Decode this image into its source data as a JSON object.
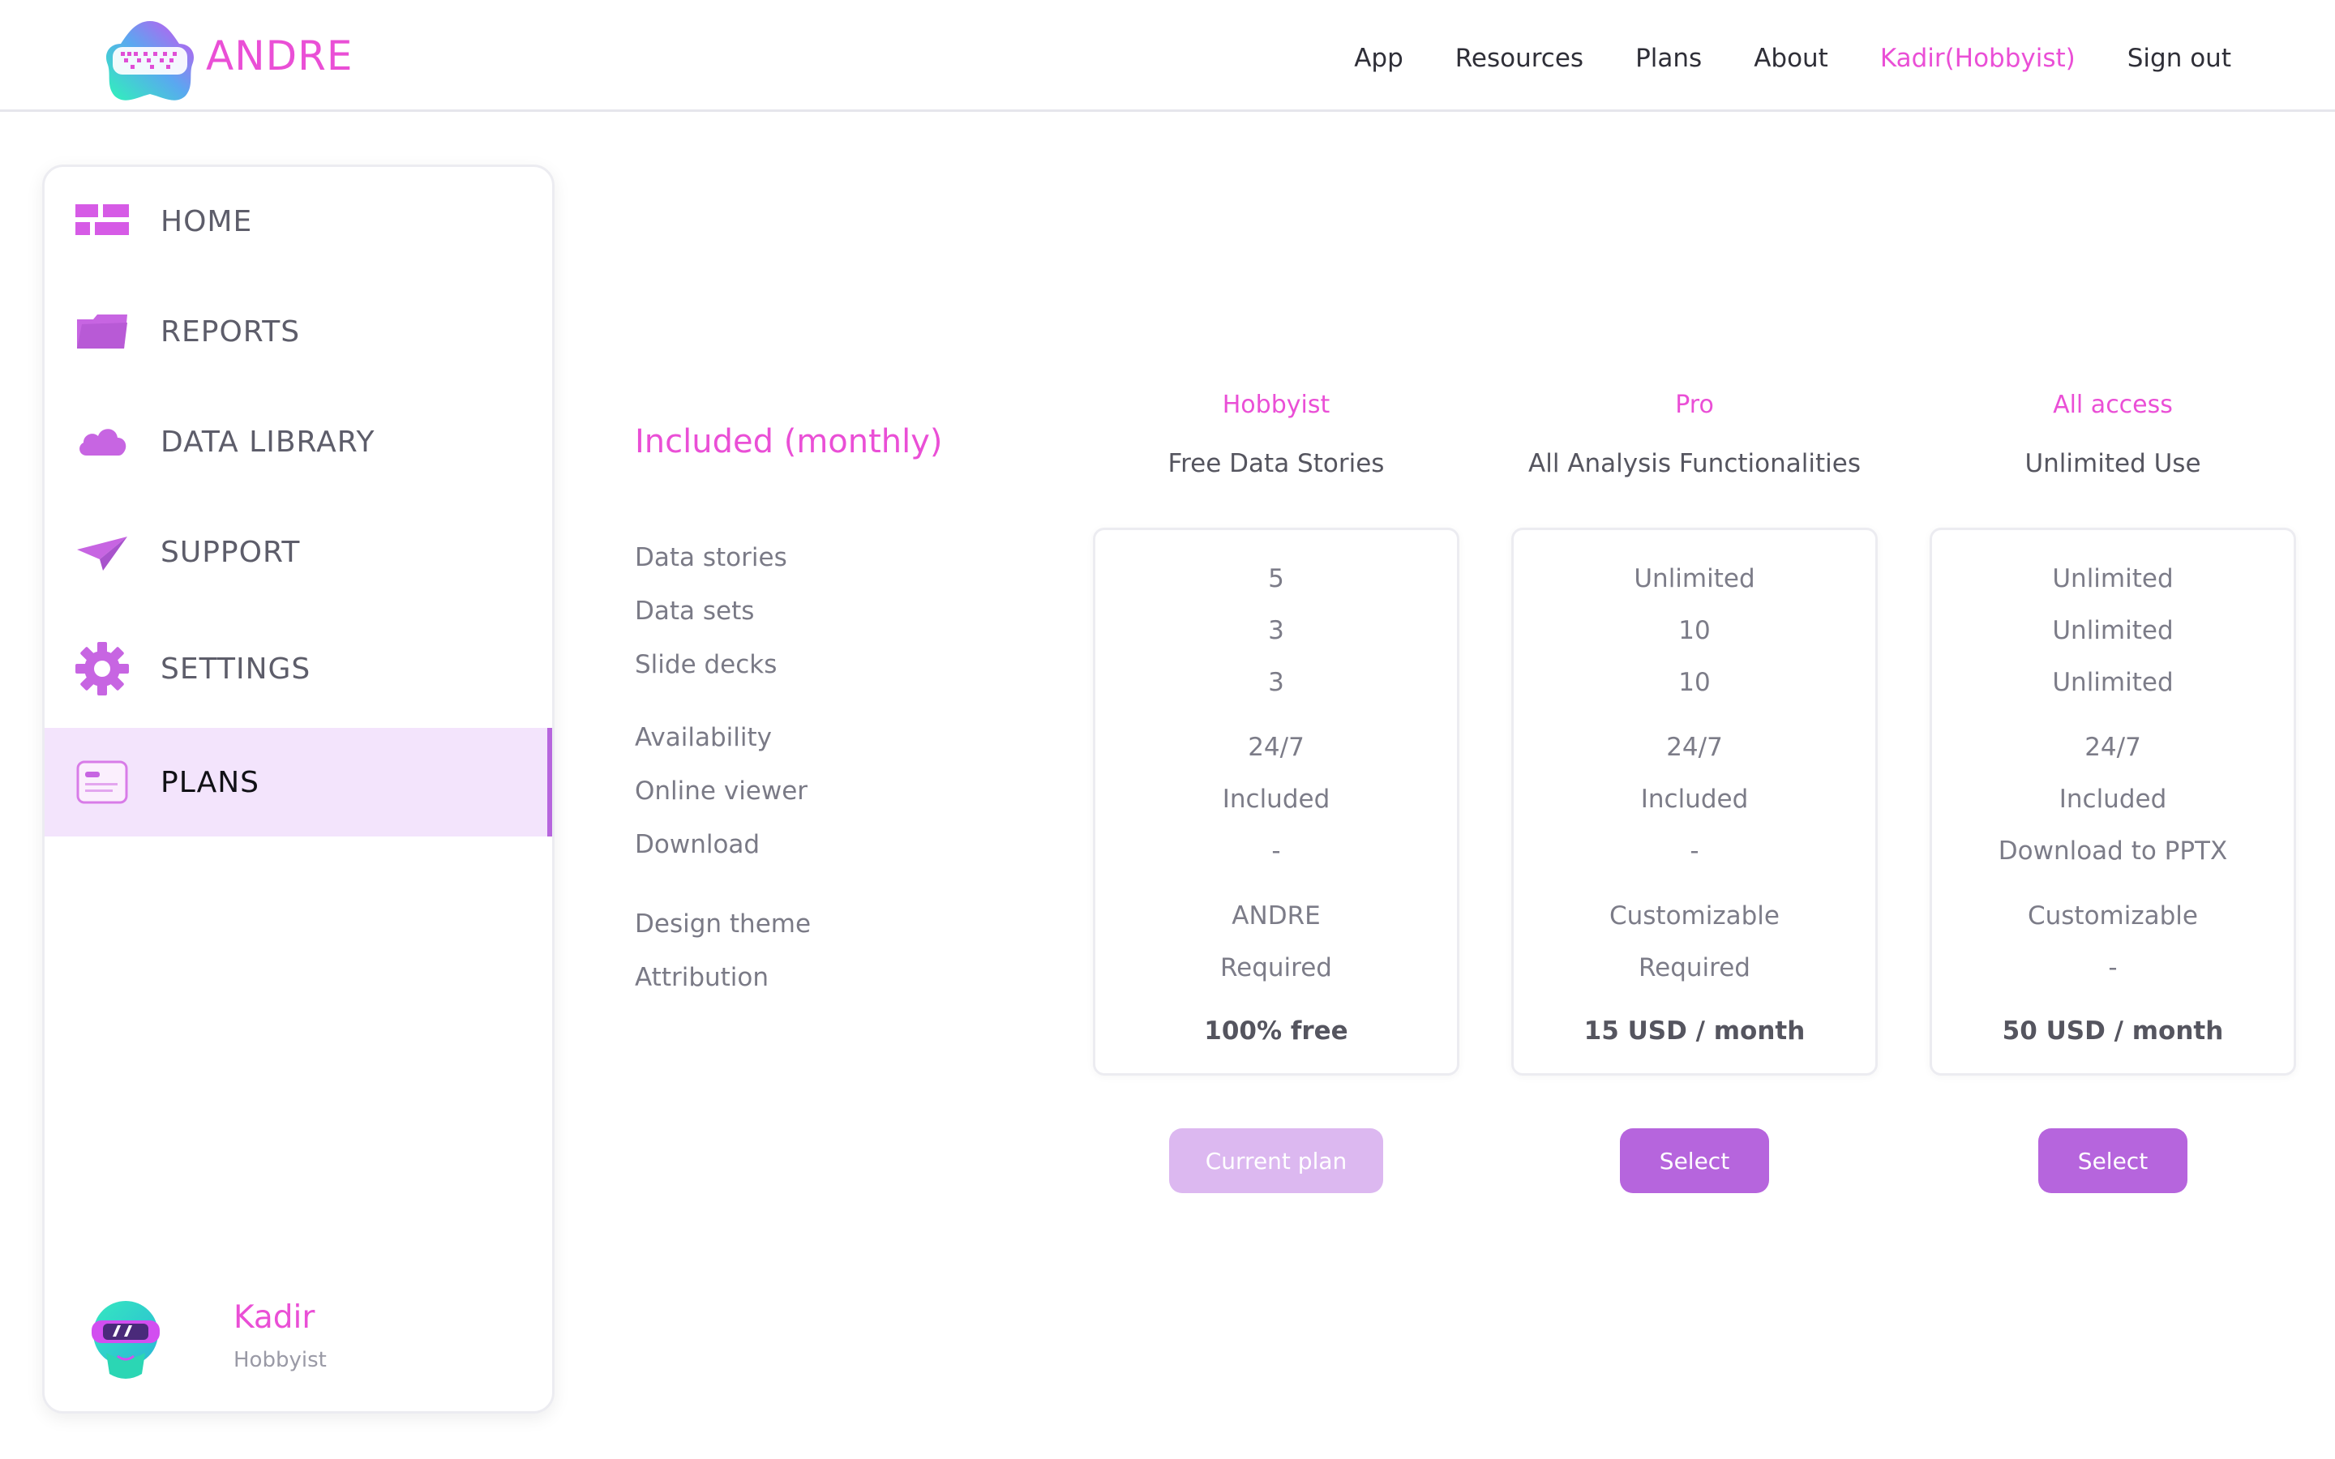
{
  "brand": {
    "name": "ANDRE"
  },
  "nav": {
    "items": [
      "App",
      "Resources",
      "Plans",
      "About",
      "Kadir(Hobbyist)",
      "Sign out"
    ]
  },
  "sidebar": {
    "items": [
      {
        "label": "HOME",
        "icon": "home-grid-icon"
      },
      {
        "label": "REPORTS",
        "icon": "folder-icon"
      },
      {
        "label": "DATA LIBRARY",
        "icon": "cloud-icon"
      },
      {
        "label": "SUPPORT",
        "icon": "paper-plane-icon"
      },
      {
        "label": "SETTINGS",
        "icon": "gear-icon"
      },
      {
        "label": "PLANS",
        "icon": "card-icon"
      }
    ],
    "active": "PLANS",
    "accent": "#b665dd"
  },
  "user": {
    "name": "Kadir",
    "plan": "Hobbyist"
  },
  "included": {
    "title": "Included (monthly)",
    "features": [
      "Data stories",
      "Data sets",
      "Slide decks",
      "Availability",
      "Online viewer",
      "Download",
      "Design theme",
      "Attribution"
    ]
  },
  "plans": [
    {
      "name": "Hobbyist",
      "subtitle": "Free Data Stories",
      "values": [
        "5",
        "3",
        "3",
        "24/7",
        "Included",
        "-",
        "ANDRE",
        "Required"
      ],
      "price": "100% free",
      "button": "Current plan"
    },
    {
      "name": "Pro",
      "subtitle": "All Analysis Functionalities",
      "values": [
        "Unlimited",
        "10",
        "10",
        "24/7",
        "Included",
        "-",
        "Customizable",
        "Required"
      ],
      "price": "15 USD / month",
      "button": "Select"
    },
    {
      "name": "All access",
      "subtitle": "Unlimited Use",
      "values": [
        "Unlimited",
        "Unlimited",
        "Unlimited",
        "24/7",
        "Included",
        "Download to PPTX",
        "Customizable",
        "-"
      ],
      "price": "50 USD / month",
      "button": "Select"
    }
  ],
  "colors": {
    "brand_pink": "#ea4fd6",
    "purple": "#b665dd",
    "light_purple": "#f3e4fc"
  }
}
